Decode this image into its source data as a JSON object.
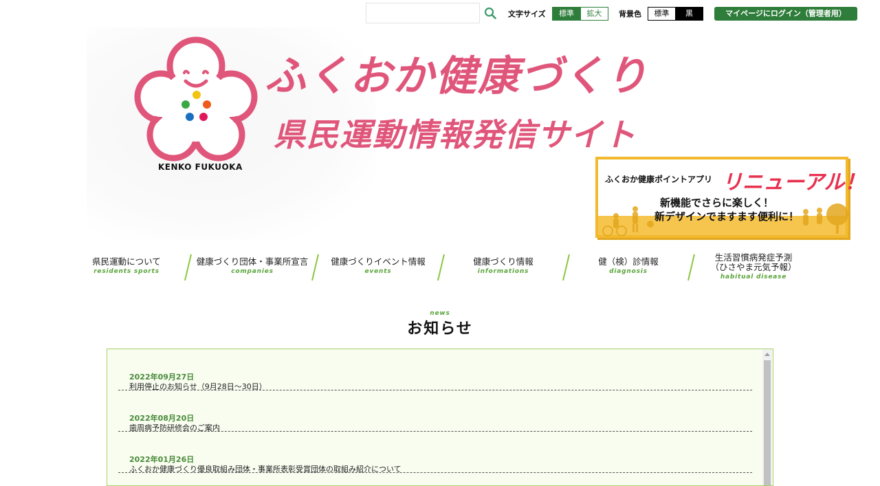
{
  "utility": {
    "search": {
      "value": "",
      "placeholder": "",
      "icon": "search-icon"
    },
    "font_size": {
      "label": "文字サイズ",
      "options": [
        "標準",
        "拡大"
      ],
      "selected": "標準"
    },
    "background": {
      "label": "背景色",
      "options": [
        "標準",
        "黒"
      ],
      "selected": "標準"
    },
    "login_button": "マイページにログイン（管理者用）",
    "accent_color": "#2e7d3a"
  },
  "header": {
    "logo_caption": "KENKO FUKUOKA",
    "title": "ふくおか健康づくり",
    "subtitle": "県民運動情報発信サイト",
    "brand_color": "#e0567b"
  },
  "promo": {
    "app_name": "ふくおか健康ポイントアプリ",
    "headline": "リニューアル！",
    "line1": "新機能でさらに楽しく！",
    "line2": "新デザインでますます便利に！"
  },
  "nav": {
    "items": [
      {
        "label": "県民運動について",
        "sub": "residents sports"
      },
      {
        "label": "健康づくり団体・事業所宣言",
        "sub": "companies"
      },
      {
        "label": "健康づくりイベント情報",
        "sub": "events"
      },
      {
        "label": "健康づくり情報",
        "sub": "informations"
      },
      {
        "label": "健（検）診情報",
        "sub": "diagnosis"
      },
      {
        "label": "生活習慣病発症予測",
        "label2": "（ひさやま元気予報）",
        "sub": "habitual disease"
      }
    ]
  },
  "news": {
    "heading_en": "news",
    "heading": "お知らせ",
    "items": [
      {
        "date": "2022年09月27日",
        "title": "利用停止のお知らせ（9月28日～30日）"
      },
      {
        "date": "2022年08月20日",
        "title": "歯周病予防研修会のご案内"
      },
      {
        "date": "2022年01月26日",
        "title": "ふくおか健康づくり優良取組み団体・事業所表彰受賞団体の取組み紹介について"
      }
    ]
  }
}
